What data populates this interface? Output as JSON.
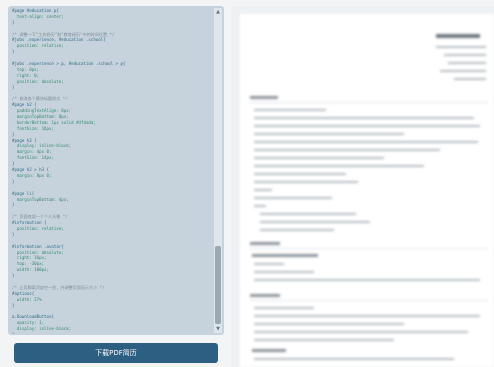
{
  "editor": {
    "lines": [
      "#page #education p{",
      "  text-align: center;",
      "}",
      "",
      "/* 调整一下\"工作经历\"和\"教育经历\"中的时间位置 */",
      "#jobs .experience, #education .school{",
      "  position: relative;",
      "}",
      "",
      "#jobs .experience > p, #education .school > p{",
      "  top: 0px;",
      "  right: 0;",
      "  position: absolute;",
      "}",
      "",
      "/* 修改各个模块标题样式 */",
      "#page h2 {",
      "  paddingTextAlign: 8px;",
      "  marginTopBottom: 8px;",
      "  borderBottom: 1px solid #dfdada;",
      "  fontSize: 16px;",
      "}",
      "#page h3 {",
      "  display: inline-block;",
      "  margin: 4px 0;",
      "  fontSize: 14px;",
      "}",
      "#page h2 > h3 {",
      "  margin: 8px 0;",
      "}",
      "",
      "#page li{",
      "  marginTopBottom: 4px;",
      "}",
      "",
      "/* 页面底部一个个人头像 */",
      "#information {",
      "  position: relative;",
      "}",
      "",
      "#information .avatar{",
      "  position: absolute;",
      "  right: 16px;",
      "  top: -30px;",
      "  width: 100px;",
      "}",
      "",
      "/* 让页脚离顶部空一些，并调整页面显示大小 */",
      "#options{",
      "  width: 27%",
      "}",
      "",
      "a.DownloadButton{",
      "  opacity: 1;",
      "  display: inline-block;",
      "}",
      "",
      "/*",
      " * 加上你喜爱的个人博客",
      " * 保存好好保存",
      " * 简历模板 2016/5/29",
      " */"
    ],
    "scroll_up_glyph": "▲",
    "scroll_down_glyph": "▼"
  },
  "download_button": {
    "label": "下载PDF简历"
  },
  "preview": {
    "blurred": true
  }
}
